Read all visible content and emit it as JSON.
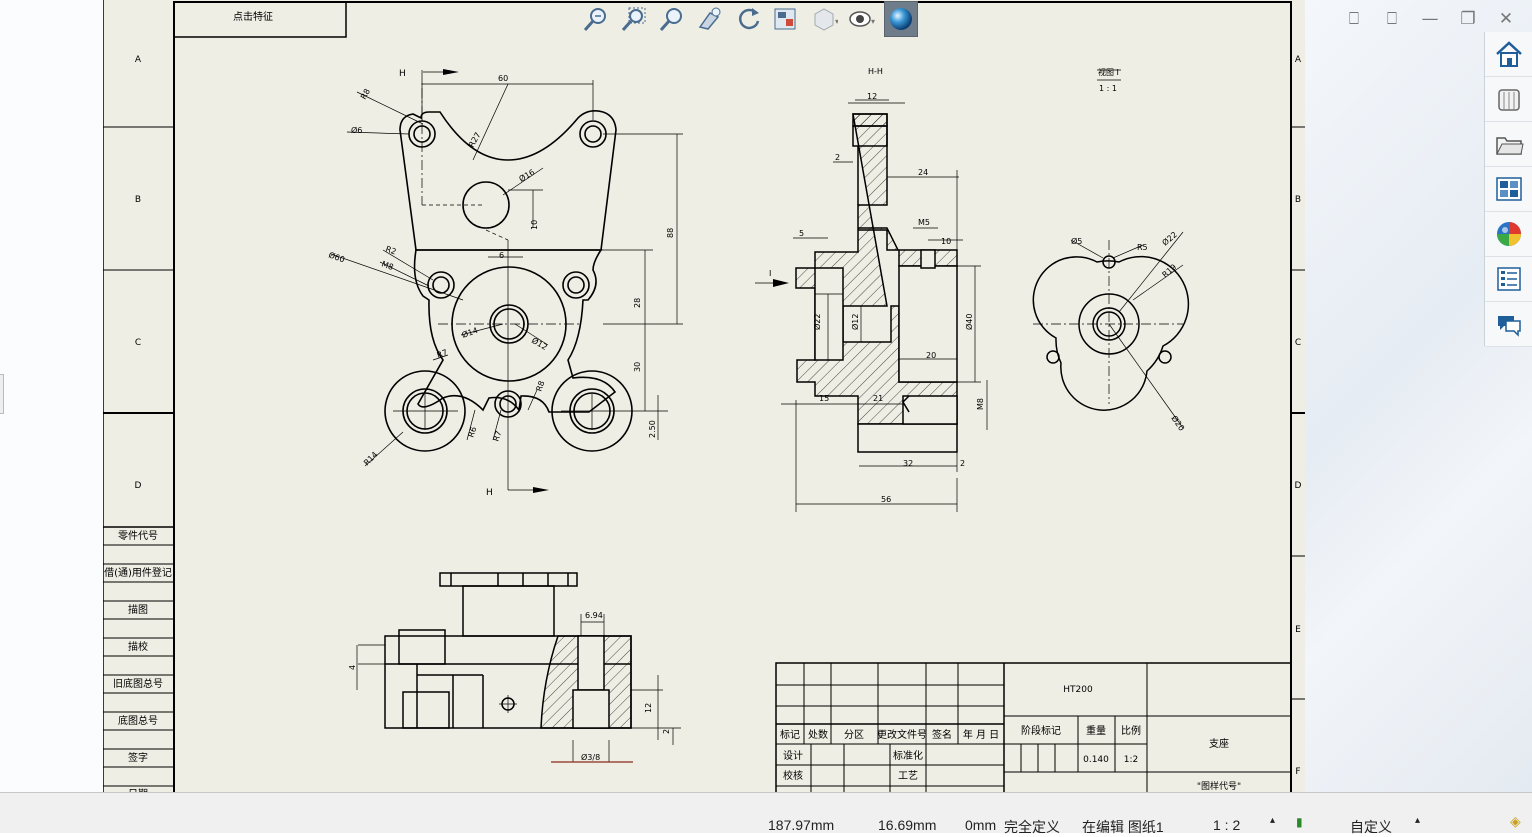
{
  "hud_toolbar": {
    "items": [
      "zoom-to-fit-icon",
      "zoom-to-area-icon",
      "zoom-in-out-icon",
      "previous-view-icon",
      "rotate-view-icon",
      "section-view-icon",
      "display-style-icon",
      "hide-show-icon",
      "appearance-icon"
    ]
  },
  "window": {
    "controls": [
      "restore-left",
      "restore-right",
      "minimize",
      "maximize",
      "close"
    ],
    "ctrl_glyphs": [
      "⎕",
      "⎕",
      "—",
      "❐",
      "✕"
    ]
  },
  "task_pane": {
    "items": [
      "home-icon",
      "design-library-icon",
      "file-explorer-icon",
      "view-palette-icon",
      "appearances-icon",
      "custom-properties-icon",
      "forum-icon"
    ]
  },
  "drawing": {
    "zone_letters": [
      "A",
      "B",
      "C",
      "D",
      "E",
      "F"
    ],
    "note_box": "点击特征",
    "view_label": "视图 I",
    "view_scale": "1 : 1",
    "section_label": "H-H",
    "section_marker": "H",
    "side_arrow": "I",
    "front_dims": [
      "60",
      "R8",
      "Ø6",
      "R27",
      "Ø16",
      "10",
      "88",
      "6",
      "Ø60",
      "R2",
      "M8",
      "28",
      "Ø14",
      "Ø12",
      "30",
      "R7",
      "R8",
      "R6",
      "R7",
      "R14",
      "2.50"
    ],
    "section_dims": [
      "12",
      "2",
      "24",
      "5",
      "M5",
      "10",
      "Ø22",
      "Ø12",
      "Ø40",
      "20",
      "15",
      "21",
      "M8",
      "32",
      "2",
      "56"
    ],
    "aux_dims": [
      "Ø5",
      "R5",
      "Ø22",
      "R19",
      "Ø20"
    ],
    "bottom_dims": [
      "6.94",
      "4",
      "12",
      "2",
      "Ø3/8"
    ],
    "side_table": [
      "零件代号",
      "借(通)用件登记",
      "描图",
      "描校",
      "旧底图总号",
      "底图总号",
      "签字",
      "日期"
    ],
    "title_block": {
      "material": "HT200",
      "headers": [
        "标记",
        "处数",
        "分区",
        "更改文件号",
        "签名",
        "年 月 日"
      ],
      "rows": [
        "设计",
        "标准化",
        "校核",
        "工艺"
      ],
      "stage": "阶段标记",
      "weight_label": "重量",
      "scale_label": "比例",
      "weight": "0.140",
      "scale": "1:2",
      "part_name": "支座",
      "drawing_no": "\"图样代号\""
    }
  },
  "status": {
    "x": "187.97mm",
    "y": "16.69mm",
    "z": "0mm",
    "state": "完全定义",
    "editing": "在编辑 图纸1",
    "scale": "1 : 2",
    "units": "自定义"
  },
  "colors": {
    "sheet": "#eeeee4",
    "line": "#000000",
    "active_tool": "#6f7c8a"
  }
}
